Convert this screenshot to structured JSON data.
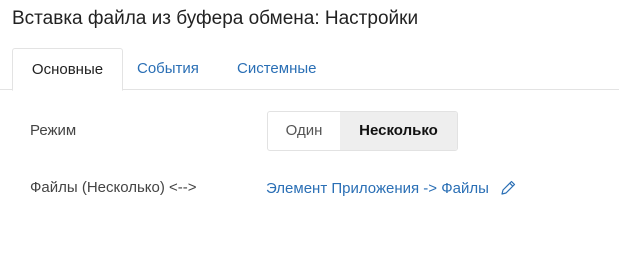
{
  "dialog": {
    "title": "Вставка файла из буфера обмена: Настройки"
  },
  "tabs": [
    {
      "label": "Основные",
      "active": true
    },
    {
      "label": "События",
      "active": false
    },
    {
      "label": "Системные",
      "active": false
    }
  ],
  "settings": {
    "mode": {
      "label": "Режим",
      "options": [
        "Один",
        "Несколько"
      ],
      "selected": "Несколько"
    },
    "files": {
      "label": "Файлы (Несколько) <-->",
      "value": "Элемент Приложения -> Файлы",
      "icon": "pencil-icon"
    }
  },
  "colors": {
    "link": "#2a6fb5",
    "selected_bg": "#eeeeee"
  }
}
